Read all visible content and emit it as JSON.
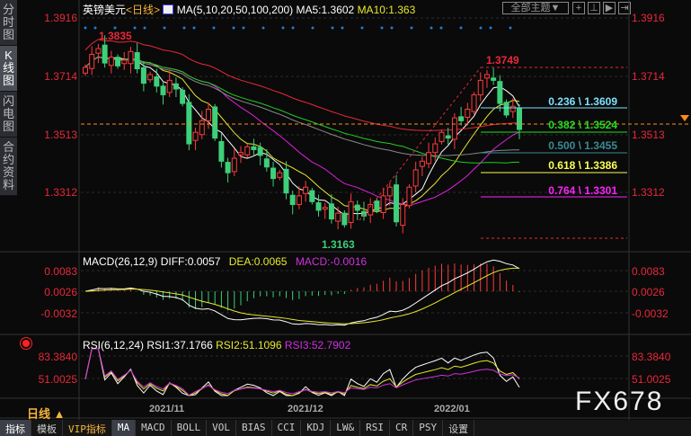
{
  "sidebar": {
    "tabs": [
      {
        "label": "分时图"
      },
      {
        "label": "K线图"
      },
      {
        "label": "闪电图"
      },
      {
        "label": "合约资料"
      }
    ]
  },
  "header": {
    "symbol": "英镑美元",
    "period": "<日线>",
    "ma_label": "MA(5,10,20,50,100,200)",
    "ma5": "MA5:1.3602",
    "ma10": "MA10:1.363",
    "theme": "全部主题▼"
  },
  "price_axis": [
    "1.3916",
    "1.3714",
    "1.3513",
    "1.3312"
  ],
  "annotations": {
    "high": "1.3835",
    "recent_high": "1.3749",
    "low": "1.3163"
  },
  "fib": [
    {
      "label": "0.236 \\ 1.3609",
      "color": "#7fe0ff"
    },
    {
      "label": "0.382 \\ 1.3524",
      "color": "#22dd22"
    },
    {
      "label": "0.500 \\ 1.3455",
      "color": "#3a8a96"
    },
    {
      "label": "0.618 \\ 1.3386",
      "color": "#ffff55"
    },
    {
      "label": "0.764 \\ 1.3301",
      "color": "#ff22ff"
    }
  ],
  "macd": {
    "title": "MACD(26,12,9)",
    "diff": "DIFF:0.0057",
    "dea": "DEA:0.0065",
    "macd": "MACD:-0.0016",
    "axis": [
      "0.0083",
      "0.0026",
      "-0.0032"
    ]
  },
  "rsi": {
    "title": "RSI(6,12,24)",
    "rsi1": "RSI1:37.1766",
    "rsi2": "RSI2:51.1096",
    "rsi3": "RSI3:52.7902",
    "axis": [
      "83.3840",
      "51.0025"
    ]
  },
  "dates": [
    "2021/11",
    "2021/12",
    "2022/01"
  ],
  "period_label": "日线 ▲",
  "watermark": "FX678",
  "tabs": [
    "指标",
    "模板",
    "VIP指标",
    "MA",
    "MACD",
    "BOLL",
    "VOL",
    "BIAS",
    "CCI",
    "KDJ",
    "LW&",
    "RSI",
    "CR",
    "PSY",
    "设置"
  ],
  "chart_data": {
    "type": "candlestick",
    "price_range": [
      1.31,
      1.396
    ],
    "closes": [
      1.3745,
      1.379,
      1.381,
      1.376,
      1.378,
      1.375,
      1.377,
      1.38,
      1.374,
      1.369,
      1.372,
      1.368,
      1.365,
      1.37,
      1.367,
      1.362,
      1.348,
      1.352,
      1.356,
      1.36,
      1.35,
      1.342,
      1.338,
      1.343,
      1.345,
      1.347,
      1.346,
      1.344,
      1.34,
      1.336,
      1.338,
      1.331,
      1.327,
      1.33,
      1.333,
      1.328,
      1.325,
      1.326,
      1.322,
      1.324,
      1.32,
      1.328,
      1.325,
      1.323,
      1.327,
      1.325,
      1.33,
      1.333,
      1.321,
      1.327,
      1.333,
      1.339,
      1.342,
      1.345,
      1.348,
      1.352,
      1.35,
      1.357,
      1.356,
      1.36,
      1.365,
      1.37,
      1.372,
      1.37,
      1.362,
      1.358,
      1.361,
      1.353
    ]
  }
}
